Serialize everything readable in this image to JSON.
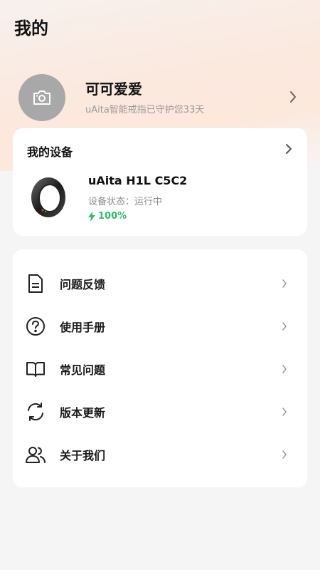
{
  "header": {
    "title": "我的"
  },
  "profile": {
    "name": "可可爱爱",
    "subtitle": "uAita智能戒指已守护您33天"
  },
  "device": {
    "section_title": "我的设备",
    "name": "uAita H1L C5C2",
    "status": "设备状态：运行中",
    "battery": "100%"
  },
  "menu": {
    "items": [
      {
        "label": "问题反馈",
        "icon": "document-icon"
      },
      {
        "label": "使用手册",
        "icon": "help-circle-icon"
      },
      {
        "label": "常见问题",
        "icon": "book-icon"
      },
      {
        "label": "版本更新",
        "icon": "refresh-icon"
      },
      {
        "label": "关于我们",
        "icon": "users-icon"
      }
    ]
  },
  "colors": {
    "accent_green": "#2fbf6a",
    "avatar_bg": "#a8a8a8"
  }
}
